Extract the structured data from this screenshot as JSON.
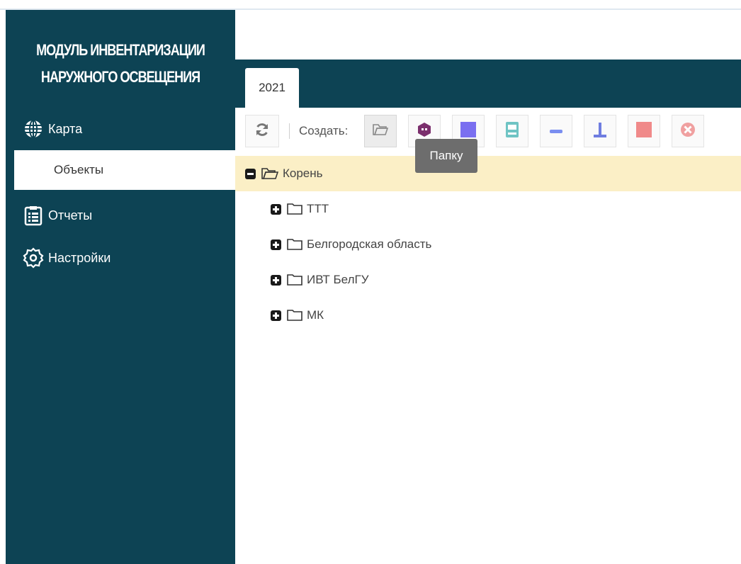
{
  "app": {
    "brand_line1": "МОДУЛЬ ИНВЕНТАРИЗАЦИИ",
    "brand_line2": "НАРУЖНОГО ОСВЕЩЕНИЯ"
  },
  "sidebar": {
    "items": [
      {
        "label": "Карта",
        "icon": "globe-grid-icon"
      },
      {
        "label": "Объекты",
        "icon": "",
        "selected": true
      },
      {
        "label": "Отчеты",
        "icon": "clipboard-list-icon"
      },
      {
        "label": "Настройки",
        "icon": "gear-icon"
      }
    ]
  },
  "tabs": [
    {
      "label": "2021",
      "active": true
    }
  ],
  "toolbar": {
    "create_label": "Создать:",
    "tooltip": "Папку",
    "buttons": [
      {
        "name": "refresh-icon",
        "color": "#777777"
      },
      {
        "name": "open-folder-icon",
        "color": "#888888"
      },
      {
        "name": "hexagon-icon",
        "color": "#7b2f6d"
      },
      {
        "name": "blue-square-icon",
        "color": "#7a6ff0"
      },
      {
        "name": "cabinet-icon",
        "color": "#6fc4c4"
      },
      {
        "name": "minus-line-icon",
        "color": "#7a8ef0"
      },
      {
        "name": "pole-icon",
        "color": "#6f7de0"
      },
      {
        "name": "red-square-icon",
        "color": "#f08a8a"
      },
      {
        "name": "cross-circle-icon",
        "color": "#f0a0a0"
      }
    ]
  },
  "tree": {
    "root": "Корень",
    "children": [
      "ТТТ",
      "Белгородская область",
      "ИВТ БелГУ",
      "МК"
    ]
  },
  "colors": {
    "sidebar_bg": "#0d4354",
    "root_highlight": "#fbefc6"
  }
}
